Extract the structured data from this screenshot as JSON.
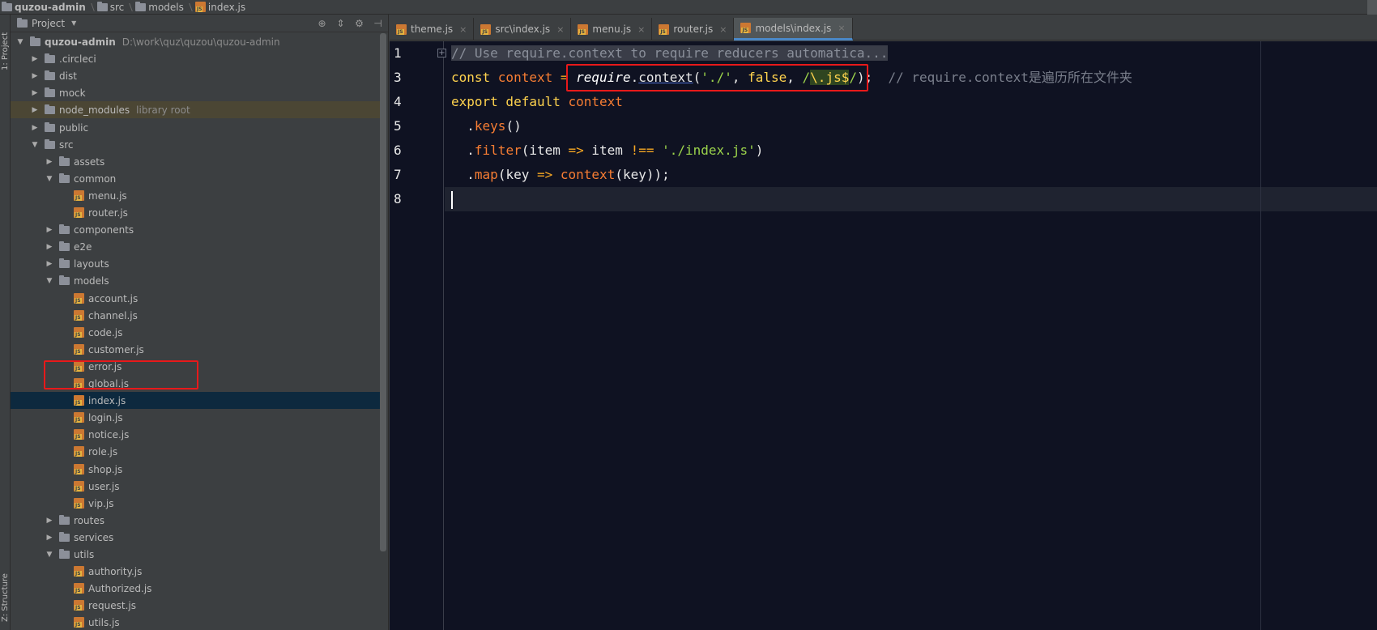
{
  "breadcrumb": [
    "quzou-admin",
    "src",
    "models",
    "index.js"
  ],
  "side_tabs": {
    "project": "1: Project",
    "structure": "Z: Structure"
  },
  "panel": {
    "title": "Project"
  },
  "tree": [
    {
      "type": "root",
      "name": "quzou-admin",
      "hint": "D:\\work\\quz\\quzou\\quzou-admin",
      "depth": 0,
      "open": true
    },
    {
      "type": "folder",
      "name": ".circleci",
      "depth": 1
    },
    {
      "type": "folder",
      "name": "dist",
      "depth": 1
    },
    {
      "type": "folder",
      "name": "mock",
      "depth": 1
    },
    {
      "type": "folder",
      "name": "node_modules",
      "hint": "library root",
      "depth": 1
    },
    {
      "type": "folder",
      "name": "public",
      "depth": 1
    },
    {
      "type": "folder",
      "name": "src",
      "depth": 1,
      "open": true
    },
    {
      "type": "folder",
      "name": "assets",
      "depth": 2
    },
    {
      "type": "folder",
      "name": "common",
      "depth": 2,
      "open": true
    },
    {
      "type": "file",
      "name": "menu.js",
      "depth": 3
    },
    {
      "type": "file",
      "name": "router.js",
      "depth": 3
    },
    {
      "type": "folder",
      "name": "components",
      "depth": 2
    },
    {
      "type": "folder",
      "name": "e2e",
      "depth": 2
    },
    {
      "type": "folder",
      "name": "layouts",
      "depth": 2
    },
    {
      "type": "folder",
      "name": "models",
      "depth": 2,
      "open": true
    },
    {
      "type": "file",
      "name": "account.js",
      "depth": 3
    },
    {
      "type": "file",
      "name": "channel.js",
      "depth": 3
    },
    {
      "type": "file",
      "name": "code.js",
      "depth": 3
    },
    {
      "type": "file",
      "name": "customer.js",
      "depth": 3
    },
    {
      "type": "file",
      "name": "error.js",
      "depth": 3
    },
    {
      "type": "file",
      "name": "global.js",
      "depth": 3
    },
    {
      "type": "file",
      "name": "index.js",
      "depth": 3,
      "selected": true
    },
    {
      "type": "file",
      "name": "login.js",
      "depth": 3
    },
    {
      "type": "file",
      "name": "notice.js",
      "depth": 3
    },
    {
      "type": "file",
      "name": "role.js",
      "depth": 3
    },
    {
      "type": "file",
      "name": "shop.js",
      "depth": 3
    },
    {
      "type": "file",
      "name": "user.js",
      "depth": 3
    },
    {
      "type": "file",
      "name": "vip.js",
      "depth": 3
    },
    {
      "type": "folder",
      "name": "routes",
      "depth": 2
    },
    {
      "type": "folder",
      "name": "services",
      "depth": 2
    },
    {
      "type": "folder",
      "name": "utils",
      "depth": 2,
      "open": true
    },
    {
      "type": "file",
      "name": "authority.js",
      "depth": 3
    },
    {
      "type": "file",
      "name": "Authorized.js",
      "depth": 3
    },
    {
      "type": "file",
      "name": "request.js",
      "depth": 3
    },
    {
      "type": "file",
      "name": "utils.js",
      "depth": 3
    }
  ],
  "tabs": [
    {
      "label": "theme.js",
      "active": false
    },
    {
      "label": "src\\index.js",
      "active": false
    },
    {
      "label": "menu.js",
      "active": false
    },
    {
      "label": "router.js",
      "active": false
    },
    {
      "label": "models\\index.js",
      "active": true
    }
  ],
  "code": {
    "line_numbers": [
      "1",
      "3",
      "4",
      "5",
      "6",
      "7",
      "8"
    ],
    "l1": "// Use require.context to require reducers automatica...",
    "l3": {
      "kw": "const ",
      "var": "context",
      "eq": " = ",
      "fn": "require",
      "dot": ".",
      "call": "context",
      "p1": "(",
      "s1": "'./'",
      "c1": ", ",
      "f": "false",
      "c2": ", ",
      "re1": "/",
      "re2": "\\.",
      "re3": "js$",
      "re4": "/",
      "end": ");",
      "comment": "  // require.context是遍历所在文件夹"
    },
    "l4": {
      "kw": "export default ",
      "var": "context"
    },
    "l5": {
      "dot": "  .",
      "m": "keys",
      "rest": "()"
    },
    "l6": {
      "dot": "  .",
      "m": "filter",
      "p": "(item ",
      "ar": "=>",
      "mid": " item ",
      "op": "!==",
      "sp": " ",
      "s": "'./index.js'",
      "end": ")"
    },
    "l7": {
      "dot": "  .",
      "m": "map",
      "p": "(key ",
      "ar": "=>",
      "sp": " ",
      "c": "context",
      "end": "(key));"
    }
  },
  "colors": {
    "highlight": "#e8191a",
    "selection": "#0d293e",
    "editor_bg": "#0f1222"
  }
}
